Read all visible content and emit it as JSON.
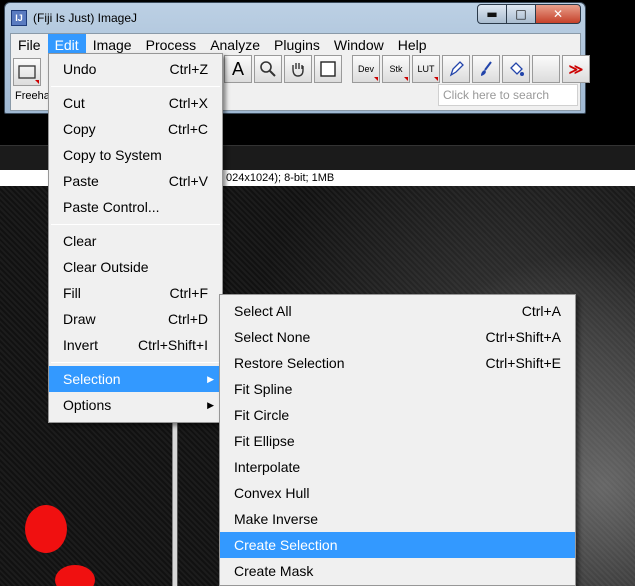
{
  "window": {
    "title": "(Fiji Is Just) ImageJ",
    "app_icon_text": "IJ",
    "min_label": "▬",
    "max_label": "□",
    "close_label": "✕"
  },
  "menu_bar": [
    {
      "label": "File"
    },
    {
      "label": "Edit"
    },
    {
      "label": "Image"
    },
    {
      "label": "Process"
    },
    {
      "label": "Analyze"
    },
    {
      "label": "Plugins"
    },
    {
      "label": "Window"
    },
    {
      "label": "Help"
    }
  ],
  "toolbar": {
    "text_tool": "A",
    "dev": "Dev",
    "stk": "Stk",
    "lut": "LUT",
    "more": "≫"
  },
  "status_text": "Freeha",
  "search": {
    "placeholder": "Click here to search"
  },
  "image_info": "024x1024); 8-bit; 1MB",
  "edit_menu": {
    "undo": {
      "label": "Undo",
      "shortcut": "Ctrl+Z"
    },
    "cut": {
      "label": "Cut",
      "shortcut": "Ctrl+X"
    },
    "copy": {
      "label": "Copy",
      "shortcut": "Ctrl+C"
    },
    "copy_to_system": {
      "label": "Copy to System"
    },
    "paste": {
      "label": "Paste",
      "shortcut": "Ctrl+V"
    },
    "paste_control": {
      "label": "Paste Control..."
    },
    "clear": {
      "label": "Clear"
    },
    "clear_outside": {
      "label": "Clear Outside"
    },
    "fill": {
      "label": "Fill",
      "shortcut": "Ctrl+F"
    },
    "draw": {
      "label": "Draw",
      "shortcut": "Ctrl+D"
    },
    "invert": {
      "label": "Invert",
      "shortcut": "Ctrl+Shift+I"
    },
    "selection": {
      "label": "Selection"
    },
    "options": {
      "label": "Options"
    }
  },
  "selection_menu": {
    "select_all": {
      "label": "Select All",
      "shortcut": "Ctrl+A"
    },
    "select_none": {
      "label": "Select None",
      "shortcut": "Ctrl+Shift+A"
    },
    "restore_selection": {
      "label": "Restore Selection",
      "shortcut": "Ctrl+Shift+E"
    },
    "fit_spline": {
      "label": "Fit Spline"
    },
    "fit_circle": {
      "label": "Fit Circle"
    },
    "fit_ellipse": {
      "label": "Fit Ellipse"
    },
    "interpolate": {
      "label": "Interpolate"
    },
    "convex_hull": {
      "label": "Convex Hull"
    },
    "make_inverse": {
      "label": "Make Inverse"
    },
    "create_selection": {
      "label": "Create Selection"
    },
    "create_mask": {
      "label": "Create Mask"
    }
  },
  "colors": {
    "highlight": "#3399ff",
    "blob": "#f01010"
  }
}
